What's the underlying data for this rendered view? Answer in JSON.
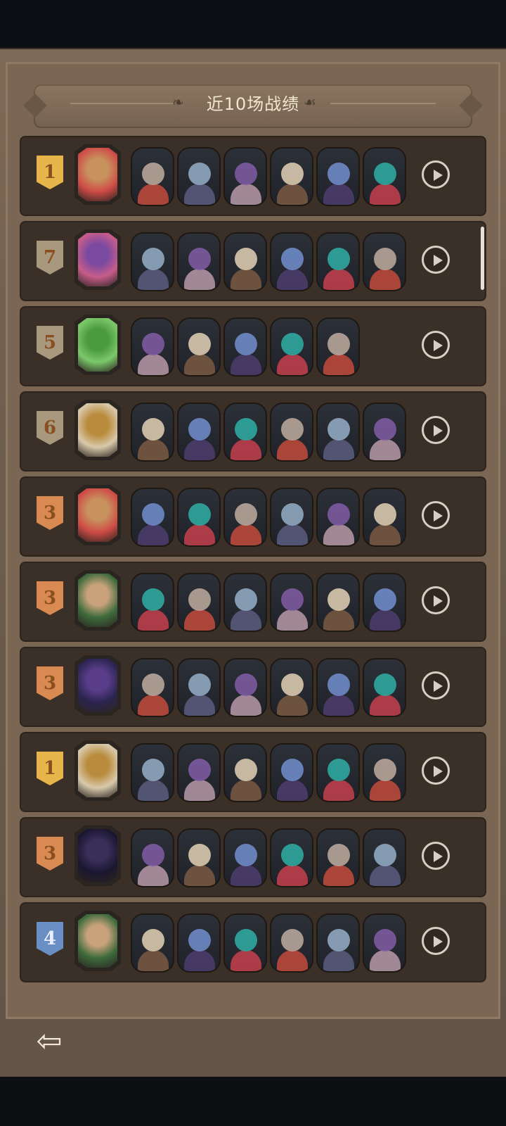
{
  "header": {
    "title": "近10场战绩"
  },
  "icons": {
    "play": "play-icon",
    "back": "back-arrow-icon"
  },
  "colors": {
    "gold": "#e8b54a",
    "bronze": "#d88a52",
    "silver": "#a8997e",
    "blue": "#6a8fc5"
  },
  "matches": [
    {
      "rank": "1",
      "tier": "gold",
      "hero": "jester",
      "units": 6
    },
    {
      "rank": "7",
      "tier": "silver",
      "hero": "octopus",
      "units": 6
    },
    {
      "rank": "5",
      "tier": "silver",
      "hero": "dryad",
      "units": 5
    },
    {
      "rank": "6",
      "tier": "silver",
      "hero": "clock",
      "units": 6
    },
    {
      "rank": "3",
      "tier": "bronze",
      "hero": "jester",
      "units": 6
    },
    {
      "rank": "3",
      "tier": "bronze",
      "hero": "old-man",
      "units": 6
    },
    {
      "rank": "3",
      "tier": "bronze",
      "hero": "beast",
      "units": 6
    },
    {
      "rank": "1",
      "tier": "gold",
      "hero": "clock",
      "units": 6
    },
    {
      "rank": "3",
      "tier": "bronze",
      "hero": "hooded",
      "units": 6
    },
    {
      "rank": "4",
      "tier": "blue",
      "hero": "old-man",
      "units": 6
    }
  ]
}
